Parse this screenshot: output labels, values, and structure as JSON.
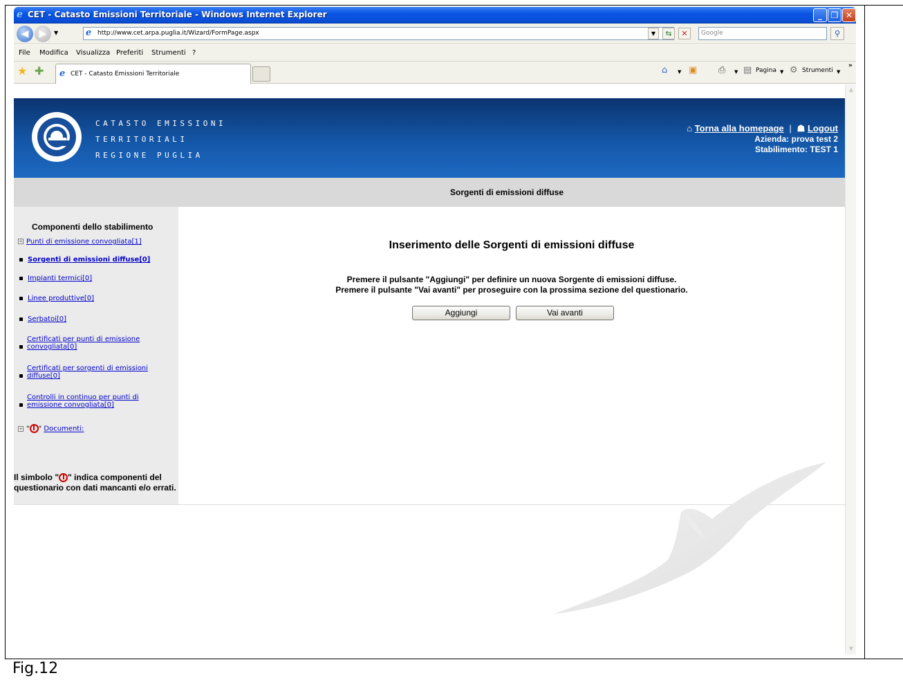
{
  "window": {
    "title": "CET - Catasto Emissioni Territoriale - Windows Internet Explorer",
    "url": "http://www.cet.arpa.puglia.it/Wizard/FormPage.aspx",
    "search_placeholder": "Google"
  },
  "menubar": [
    "File",
    "Modifica",
    "Visualizza",
    "Preferiti",
    "Strumenti",
    "?"
  ],
  "tab": {
    "label": "CET - Catasto Emissioni Territoriale"
  },
  "command_bar": {
    "page_label": "Pagina",
    "tools_label": "Strumenti"
  },
  "header": {
    "brand_lines": [
      "CATASTO EMISSIONI",
      "TERRITORIALI",
      "REGIONE PUGLIA"
    ],
    "home_link": "Torna alla homepage",
    "logout_link": "Logout",
    "azienda": "Azienda: prova test 2",
    "stabilimento": "Stabilimento: TEST 1"
  },
  "section_title": "Sorgenti di emissioni diffuse",
  "sidebar": {
    "title": "Componenti dello stabilimento",
    "items": [
      {
        "label": "Punti di emissione convogliata[1]"
      },
      {
        "label": "Sorgenti di emissioni diffuse[0]"
      },
      {
        "label": "Impianti termici[0]"
      },
      {
        "label": "Linee produttive[0]"
      },
      {
        "label": "Serbatoi[0]"
      },
      {
        "label": "Certificati per punti di emissione convogliata[0]"
      },
      {
        "label": "Certificati per sorgenti di emissioni diffuse[0]"
      },
      {
        "label": "Controlli in continuo per punti di emissione convogliata[0]"
      },
      {
        "label": "Documenti:"
      }
    ],
    "note_prefix": "Il simbolo \"",
    "note_suffix": "\" indica componenti del questionario con dati mancanti e/o errati."
  },
  "main": {
    "title": "Inserimento delle Sorgenti di emissioni diffuse",
    "instruction_1": "Premere il pulsante \"Aggiungi\" per definire un nuova Sorgente di emissioni diffuse.",
    "instruction_2": "Premere il pulsante \"Vai avanti\" per proseguire con la prossima sezione del questionario.",
    "add_button": "Aggiungi",
    "next_button": "Vai avanti"
  },
  "caption": "Fig.12"
}
